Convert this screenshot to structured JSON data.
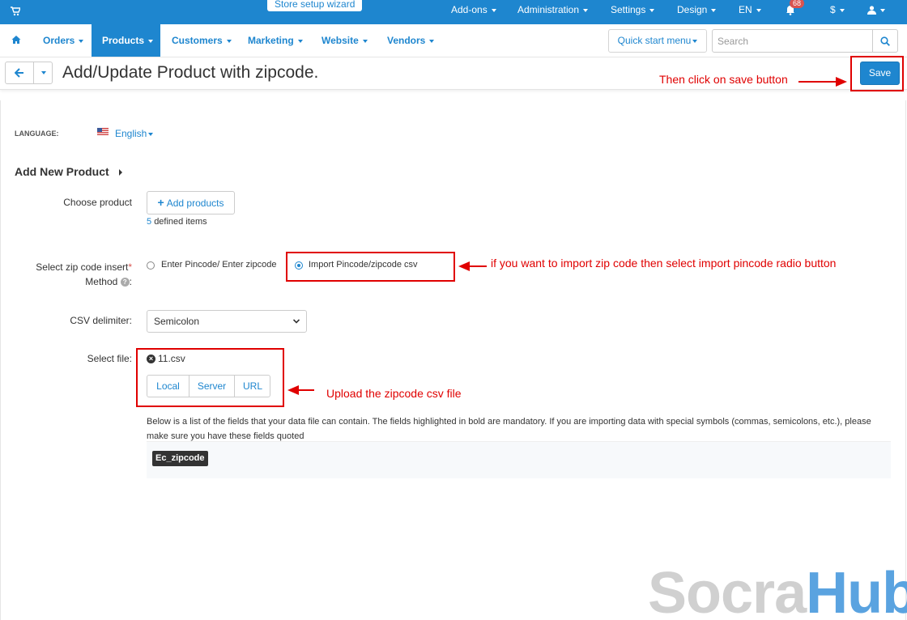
{
  "topbar": {
    "wizard": "Store setup wizard",
    "menu": [
      "Add-ons",
      "Administration",
      "Settings",
      "Design",
      "EN",
      "$"
    ],
    "notifications_count": "68",
    "bg_color": "#1e86cf"
  },
  "mainnav": {
    "items": [
      "Orders",
      "Products",
      "Customers",
      "Marketing",
      "Website",
      "Vendors"
    ],
    "active": "Products",
    "quick_start": "Quick start menu",
    "search_placeholder": "Search"
  },
  "titlebar": {
    "title": "Add/Update Product with zipcode.",
    "save": "Save"
  },
  "form": {
    "language_label": "LANGUAGE:",
    "language_value": "English",
    "section_title": "Add New Product",
    "choose_product_label": "Choose product",
    "add_products_btn": "Add products",
    "defined_count": "5",
    "defined_suffix": "defined items",
    "insert_method_label_1": "Select zip code insert",
    "insert_method_label_2": "Method",
    "radio_manual": "Enter Pincode/ Enter zipcode",
    "radio_import": "Import Pincode/zipcode csv",
    "csv_delimiter_label": "CSV delimiter:",
    "csv_delimiter_value": "Semicolon",
    "select_file_label": "Select file:",
    "file_name": "11.csv",
    "file_sources": [
      "Local",
      "Server",
      "URL"
    ],
    "info_text": "Below is a list of the fields that your data file can contain. The fields highlighted in bold are mandatory. If you are importing data with special symbols (commas, semicolons, etc.), please make sure you have these fields quoted",
    "field_tag": "Ec_zipcode"
  },
  "annotations": {
    "save_note": "Then click on save button",
    "radio_note": "if you want to import zip code then select import pincode radio button",
    "upload_note": "Upload the zipcode csv file",
    "color": "#e00000"
  },
  "watermark": {
    "part1": "Socra",
    "part2": "Hub"
  }
}
